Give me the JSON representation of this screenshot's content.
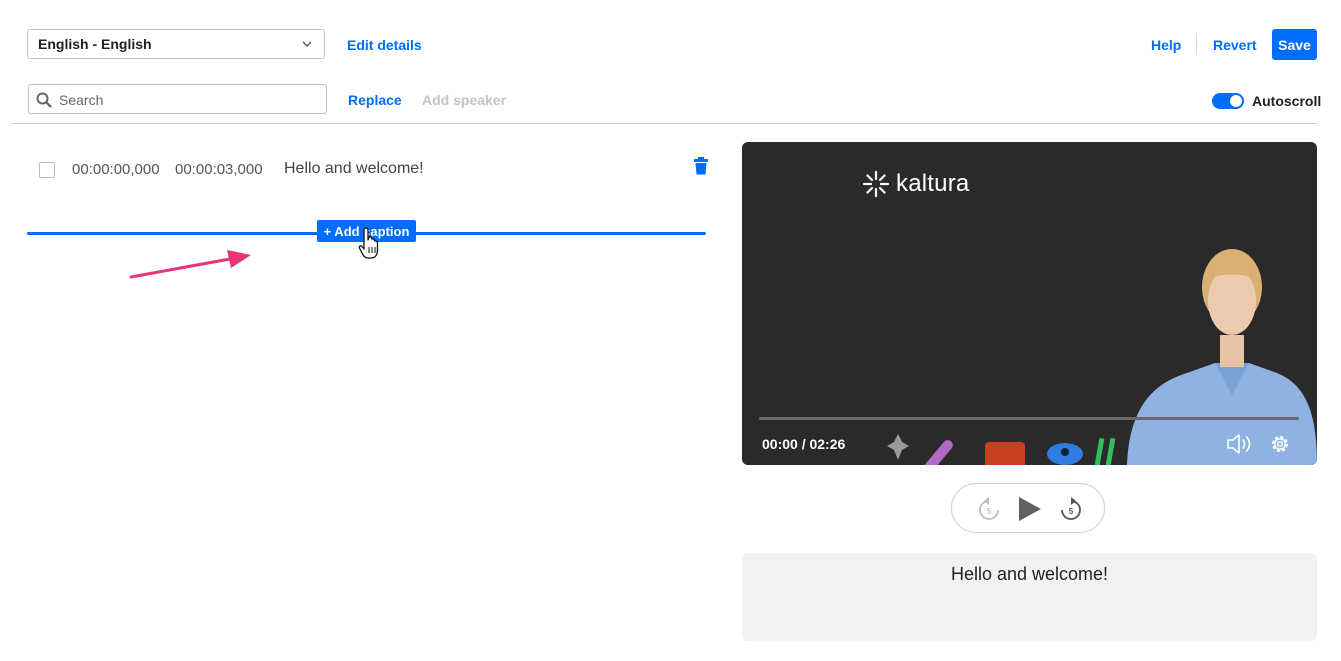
{
  "toolbar": {
    "language": "English - English",
    "edit_details": "Edit details",
    "help": "Help",
    "revert": "Revert",
    "save": "Save"
  },
  "search": {
    "placeholder": "Search",
    "replace": "Replace",
    "add_speaker": "Add speaker",
    "autoscroll_label": "Autoscroll",
    "autoscroll_on": true
  },
  "captions": [
    {
      "start": "00:00:00,000",
      "end": "00:00:03,000",
      "text": "Hello and welcome!"
    }
  ],
  "add_caption_label": "+ Add caption",
  "player": {
    "logo_text": "kaltura",
    "time": "00:00 / 02:26",
    "progress": 0
  },
  "preview_caption": "Hello and welcome!",
  "colors": {
    "accent": "#006efa",
    "arrow": "#e8357a",
    "video_bg": "#2a2a2a"
  },
  "icons": [
    "chevron-down-icon",
    "search-icon",
    "trash-icon",
    "hand-pointer-cursor-icon",
    "arrow-annotation-icon",
    "kaltura-logo-icon",
    "volume-icon",
    "settings-icon",
    "rewind-5-icon",
    "play-icon",
    "forward-5-icon"
  ]
}
